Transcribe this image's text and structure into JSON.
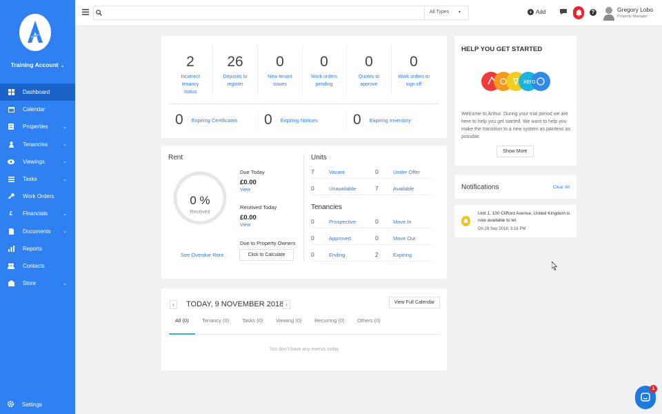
{
  "sidebar": {
    "account": "Training Account",
    "items": [
      {
        "label": "Dashboard"
      },
      {
        "label": "Calendar"
      },
      {
        "label": "Properties"
      },
      {
        "label": "Tenancies"
      },
      {
        "label": "Viewings"
      },
      {
        "label": "Tasks"
      },
      {
        "label": "Work Orders"
      },
      {
        "label": "Financials"
      },
      {
        "label": "Documents"
      },
      {
        "label": "Reports"
      },
      {
        "label": "Contacts"
      },
      {
        "label": "Store"
      }
    ],
    "settings": "Settings"
  },
  "topbar": {
    "search_placeholder": "",
    "type_select": "All Types",
    "add_label": "Add",
    "user_name": "Gregory Lobo",
    "user_role": "Property Manager"
  },
  "stats": [
    {
      "value": "2",
      "label": "Incorrect tenancy status"
    },
    {
      "value": "26",
      "label": "Deposits to register"
    },
    {
      "value": "0",
      "label": "New tenant issues"
    },
    {
      "value": "0",
      "label": "Work orders pending"
    },
    {
      "value": "0",
      "label": "Quotes to approve"
    },
    {
      "value": "0",
      "label": "Work orders to sign off"
    }
  ],
  "expiring": [
    {
      "value": "0",
      "label": "Expiring Certificates"
    },
    {
      "value": "0",
      "label": "Expiring Notices"
    },
    {
      "value": "0",
      "label": "Expiring Inventory"
    }
  ],
  "rent": {
    "title": "Rent",
    "percent": "0 %",
    "percent_label": "Received",
    "overdue_link": "See Overdue Rent",
    "due_today_label": "Due Today",
    "due_today_value": "£0.00",
    "due_today_link": "View",
    "received_today_label": "Received Today",
    "received_today_value": "£0.00",
    "received_today_link": "View",
    "owners_label": "Due to Property Owners",
    "calc_button": "Click to Calculate"
  },
  "units": {
    "title": "Units",
    "rows": [
      {
        "n1": "7",
        "l1": "Vacant",
        "n2": "0",
        "l2": "Under Offer"
      },
      {
        "n1": "0",
        "l1": "Unavailable",
        "n2": "7",
        "l2": "Available"
      }
    ]
  },
  "tenancies": {
    "title": "Tenancies",
    "rows": [
      {
        "n1": "0",
        "l1": "Prospective",
        "n2": "0",
        "l2": "Move In"
      },
      {
        "n1": "0",
        "l1": "Approved",
        "n2": "0",
        "l2": "Move Out"
      },
      {
        "n1": "0",
        "l1": "Ending",
        "n2": "2",
        "l2": "Expiring"
      }
    ]
  },
  "calendar": {
    "prev": "‹",
    "next": "›",
    "title": "TODAY, 9 NOVEMBER 2018",
    "full_button": "View Full Calendar",
    "tabs": [
      "All (0)",
      "Tenancy (0)",
      "Tasks (0)",
      "Viewing (0)",
      "Recurring (0)",
      "Others (0)"
    ],
    "empty": "You don't have any events today"
  },
  "help": {
    "title": "HELP YOU GET STARTED",
    "xero_text": "xero",
    "text": "Welcome to Arthur. During your trial period we are here to help you get started. We want to help you make the transition to a new system as painless as possible.",
    "show_more": "Show More"
  },
  "notifications": {
    "title": "Notifications",
    "clear_all": "Clear All",
    "item_text": "Unit 1, 100 Clifford Avenue, United Kingdom is now available to let",
    "item_time": "On 28 Sep 2018, 3:16 PM"
  },
  "chat_badge": "1",
  "colors": {
    "sidebar": "#2f80f0",
    "accent": "#2b7be4",
    "alert": "#e8262e",
    "notif": "#f5c11d",
    "teal": "#3cb4b4"
  }
}
